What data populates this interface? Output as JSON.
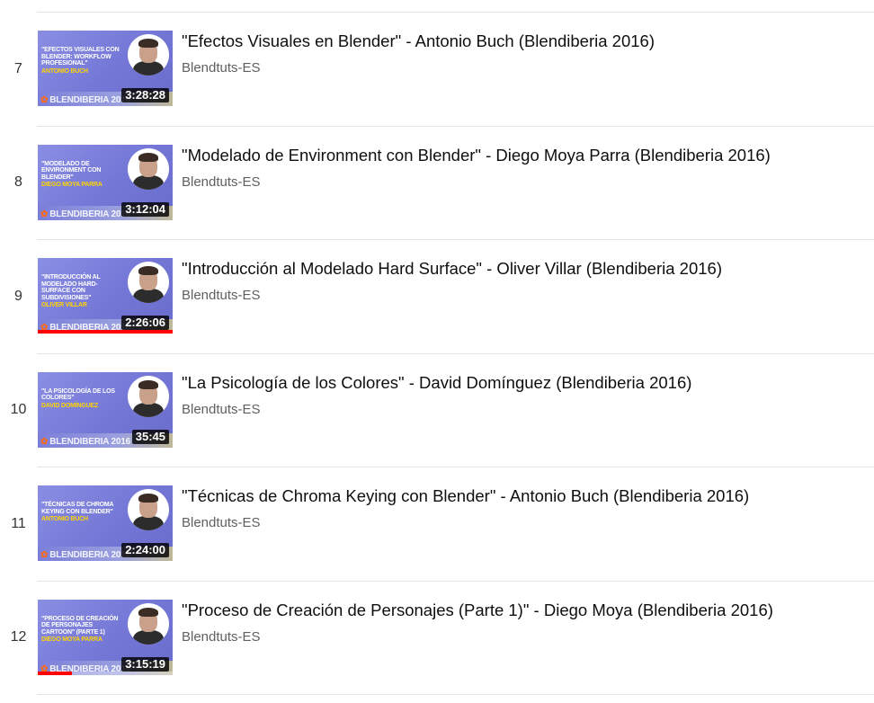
{
  "playlist": {
    "items": [
      {
        "index": "7",
        "title": "\"Efectos Visuales en Blender\" - Antonio Buch (Blendiberia 2016)",
        "channel": "Blendtuts-ES",
        "duration": "3:28:28",
        "thumb_talk": "\"Efectos visuales con Blender: Workflow profesional\"",
        "thumb_speaker": "Antonio Buch",
        "thumb_event": "BLENDIBERIA 2016",
        "watched_fraction": 0
      },
      {
        "index": "8",
        "title": "\"Modelado de Environment con Blender\" - Diego Moya Parra (Blendiberia 2016)",
        "channel": "Blendtuts-ES",
        "duration": "3:12:04",
        "thumb_talk": "\"Modelado de Environment con Blender\"",
        "thumb_speaker": "Diego Moya Parra",
        "thumb_event": "BLENDIBERIA 2016",
        "watched_fraction": 0
      },
      {
        "index": "9",
        "title": "\"Introducción al Modelado Hard Surface\" - Oliver Villar (Blendiberia 2016)",
        "channel": "Blendtuts-ES",
        "duration": "2:26:06",
        "thumb_talk": "\"Introducción al modelado Hard-Surface con subdivisiones\"",
        "thumb_speaker": "Oliver Villar",
        "thumb_event": "BLENDIBERIA 2016",
        "watched_fraction": 1
      },
      {
        "index": "10",
        "title": "\"La Psicología de los Colores\" - David Domínguez (Blendiberia 2016)",
        "channel": "Blendtuts-ES",
        "duration": "35:45",
        "thumb_talk": "\"La Psicología de los Colores\"",
        "thumb_speaker": "David Domínguez",
        "thumb_event": "BLENDIBERIA 2016",
        "watched_fraction": 0
      },
      {
        "index": "11",
        "title": "\"Técnicas de Chroma Keying con Blender\" - Antonio Buch (Blendiberia 2016)",
        "channel": "Blendtuts-ES",
        "duration": "2:24:00",
        "thumb_talk": "\"Técnicas de Chroma Keying con Blender\"",
        "thumb_speaker": "Antonio Buch",
        "thumb_event": "BLENDIBERIA 2016",
        "watched_fraction": 0
      },
      {
        "index": "12",
        "title": "\"Proceso de Creación de Personajes (Parte 1)\" - Diego Moya (Blendiberia 2016)",
        "channel": "Blendtuts-ES",
        "duration": "3:15:19",
        "thumb_talk": "\"Proceso de creación de personajes cartoon\" (Parte 1)",
        "thumb_speaker": "Diego Moya Parra",
        "thumb_event": "BLENDIBERIA 2016",
        "watched_fraction": 0.25
      }
    ]
  },
  "colors": {
    "thumbnail_bg": "#7477d6",
    "progress": "#ff0000",
    "speaker_text": "#ffd400",
    "channel_text": "#606060"
  }
}
